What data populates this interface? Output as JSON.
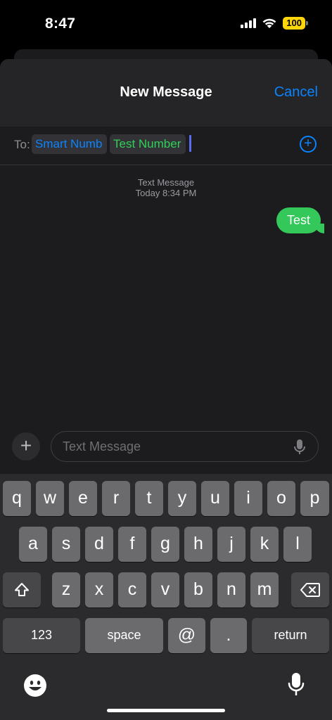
{
  "status": {
    "time": "8:47",
    "battery": "100"
  },
  "header": {
    "title": "New Message",
    "cancel": "Cancel"
  },
  "recipients": {
    "to_label": "To:",
    "chips": [
      "Smart Numb",
      "Test Number"
    ]
  },
  "conversation": {
    "service": "Text Message",
    "timestamp": "Today 8:34 PM",
    "messages": [
      {
        "text": "Test",
        "sender": "me"
      }
    ]
  },
  "composer": {
    "placeholder": "Text Message",
    "plus": "+"
  },
  "keyboard": {
    "row1": [
      "q",
      "w",
      "e",
      "r",
      "t",
      "y",
      "u",
      "i",
      "o",
      "p"
    ],
    "row2": [
      "a",
      "s",
      "d",
      "f",
      "g",
      "h",
      "j",
      "k",
      "l"
    ],
    "row3": [
      "z",
      "x",
      "c",
      "v",
      "b",
      "n",
      "m"
    ],
    "numbers": "123",
    "space": "space",
    "at": "@",
    "period": ".",
    "return": "return"
  },
  "colors": {
    "accent": "#0a84ff",
    "bubble": "#34c759",
    "recipient_green": "#30d158",
    "battery": "#ffd60a"
  }
}
